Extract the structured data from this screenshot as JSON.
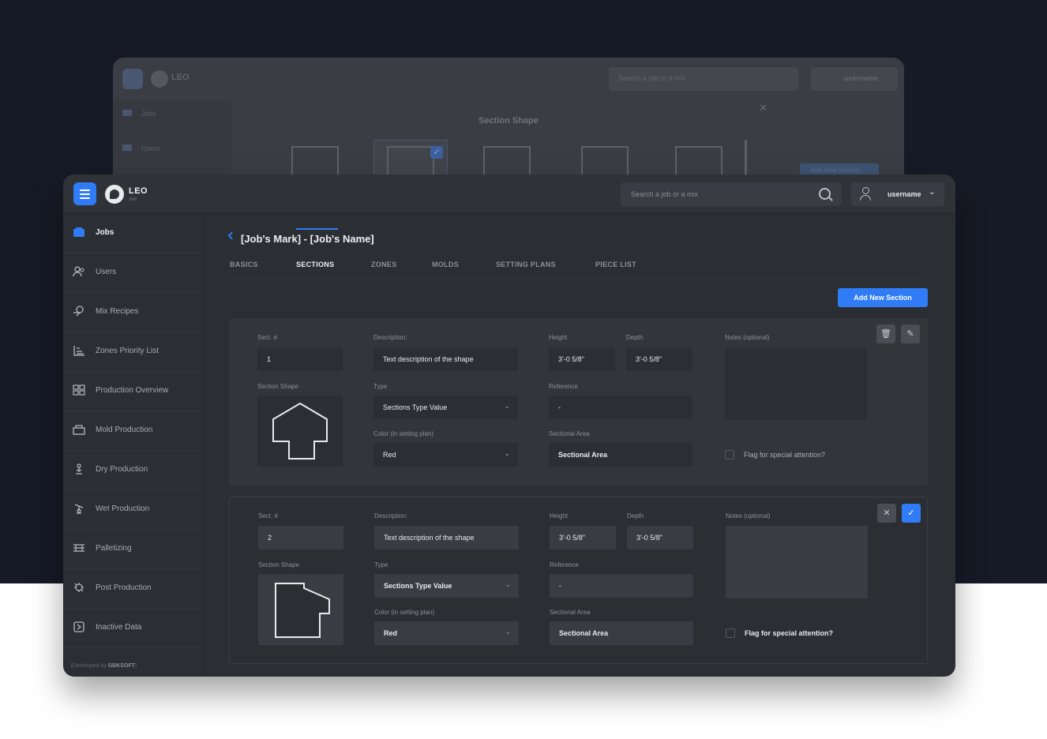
{
  "background_window": {
    "app_name": "LEO",
    "search_placeholder": "Search a job or a mix",
    "username": "username",
    "sidebar_items": [
      "Jobs",
      "Users"
    ],
    "modal_title": "Section Shape",
    "modal_button": "Add New Section"
  },
  "app": {
    "name": "LEO",
    "subtitle": "mix"
  },
  "header": {
    "search_placeholder": "Search a job or a mix",
    "username": "username"
  },
  "sidebar": {
    "items": [
      {
        "label": "Jobs",
        "icon": "jobs-icon"
      },
      {
        "label": "Users",
        "icon": "users-icon"
      },
      {
        "label": "Mix Recipes",
        "icon": "mix-recipes-icon"
      },
      {
        "label": "Zones Priority List",
        "icon": "zones-priority-icon"
      },
      {
        "label": "Production Overview",
        "icon": "production-overview-icon"
      },
      {
        "label": "Mold Production",
        "icon": "mold-production-icon"
      },
      {
        "label": "Dry Production",
        "icon": "dry-production-icon"
      },
      {
        "label": "Wet Production",
        "icon": "wet-production-icon"
      },
      {
        "label": "Palletizing",
        "icon": "palletizing-icon"
      },
      {
        "label": "Post Production",
        "icon": "post-production-icon"
      },
      {
        "label": "Inactive Data",
        "icon": "inactive-data-icon"
      }
    ],
    "footer_prefix": "[Developed by",
    "footer_brand": "GBKSOFT",
    "footer_suffix": "]"
  },
  "page": {
    "title": "[Job's Mark] - [Job's Name]",
    "tabs": [
      "BASICS",
      "SECTIONS",
      "ZONES",
      "MOLDS",
      "SETTING PLANS",
      "PIECE LIST"
    ],
    "active_tab": "SECTIONS",
    "add_button": "Add New Section"
  },
  "labels": {
    "sect_no": "Sect. #",
    "description": "Description:",
    "height": "Height",
    "depth": "Depth",
    "notes": "Notes (optional)",
    "section_shape": "Section Shape",
    "type": "Type",
    "reference": "Reference",
    "color": "Color (in setting plan)",
    "sectional_area": "Sectional Area",
    "flag": "Flag for special attention?"
  },
  "sections": [
    {
      "sect_no": "1",
      "description": "Text description of the shape",
      "height": "3'-0 5/8\"",
      "depth": "3'-0 5/8\"",
      "type": "Sections Type Value",
      "reference": "-",
      "color": "Red",
      "sectional_area": "Sectional Area"
    },
    {
      "sect_no": "2",
      "description": "Text description of the shape",
      "height": "3'-0 5/8\"",
      "depth": "3'-0 5/8\"",
      "type": "Sections Type Value",
      "reference": "-",
      "color": "Red",
      "sectional_area": "Sectional Area"
    }
  ],
  "colors": {
    "accent": "#2f7cf6",
    "background": "#161a26",
    "panel": "#2b2e33"
  }
}
